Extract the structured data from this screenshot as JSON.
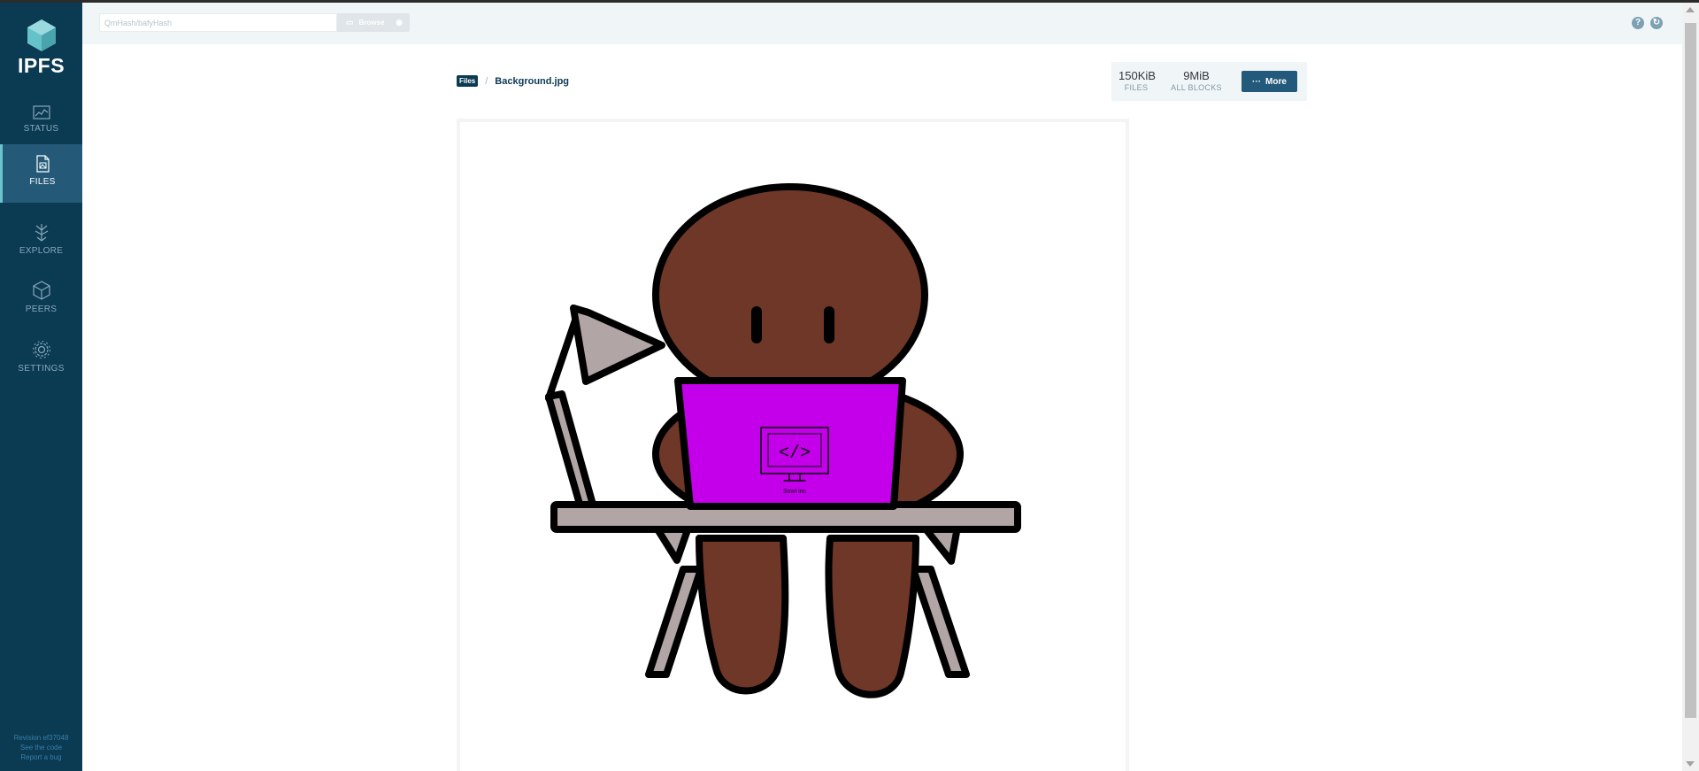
{
  "app": {
    "name": "IPFS"
  },
  "sidebar": {
    "items": [
      {
        "label": "STATUS",
        "icon": "status-chart-icon",
        "active": false
      },
      {
        "label": "FILES",
        "icon": "files-icon",
        "active": true
      },
      {
        "label": "EXPLORE",
        "icon": "explore-tree-icon",
        "active": false
      },
      {
        "label": "PEERS",
        "icon": "peers-cube-icon",
        "active": false
      },
      {
        "label": "SETTINGS",
        "icon": "settings-gear-icon",
        "active": false
      }
    ],
    "footer": {
      "revision": "Revision ef37048",
      "see_code": "See the code",
      "report_bug": "Report a bug"
    }
  },
  "topbar": {
    "search_placeholder": "QmHash/bafyHash",
    "browse_label": "Browse"
  },
  "breadcrumb": {
    "root": "Files",
    "separator": "/",
    "current": "Background.jpg"
  },
  "stats": {
    "files_value": "150KiB",
    "files_label": "FILES",
    "blocks_value": "9MiB",
    "blocks_label": "ALL BLOCKS"
  },
  "more_button": {
    "label": "More"
  },
  "preview": {
    "monitor_caption": "Suwi inc",
    "colors": {
      "skin": "#6e3728",
      "laptop": "#c400ea",
      "chair": "#b1a5a5",
      "outline": "#000000"
    }
  },
  "colors": {
    "sidebar_bg": "#0b3a53",
    "sidebar_active_bg": "#245a78",
    "accent": "#69c4cd",
    "more_button_bg": "#23597a"
  }
}
